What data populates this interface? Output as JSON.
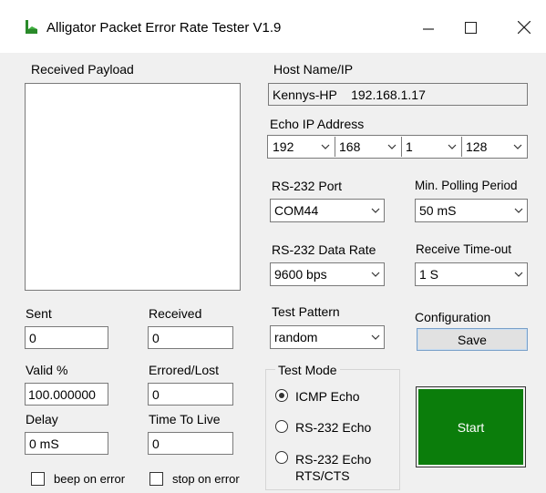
{
  "window": {
    "title": "Alligator Packet Error Rate Tester V1.9",
    "minimize_icon": "minimize-icon",
    "maximize_icon": "maximize-icon",
    "close_icon": "close-icon",
    "app_icon": "alligator-icon"
  },
  "received_payload": {
    "label": "Received Payload",
    "value": ""
  },
  "stats": {
    "sent_label": "Sent",
    "sent_value": "0",
    "received_label": "Received",
    "received_value": "0",
    "valid_label": "Valid %",
    "valid_value": "100.000000",
    "errored_label": "Errored/Lost",
    "errored_value": "0",
    "delay_label": "Delay",
    "delay_value": "0 mS",
    "ttl_label": "Time To Live",
    "ttl_value": "0"
  },
  "options": {
    "beep_label": "beep on error",
    "beep_checked": false,
    "stop_label": "stop on error",
    "stop_checked": false
  },
  "host": {
    "label": "Host Name/IP",
    "value": "Kennys-HP    192.168.1.17"
  },
  "echo_ip": {
    "label": "Echo IP Address",
    "octets": [
      "192",
      "168",
      "1",
      "128"
    ]
  },
  "rs232_port": {
    "label": "RS-232 Port",
    "value": "COM44"
  },
  "polling": {
    "label": "Min. Polling Period",
    "value": "50 mS"
  },
  "data_rate": {
    "label": "RS-232 Data Rate",
    "value": "9600 bps"
  },
  "timeout": {
    "label": "Receive Time-out",
    "value": "1 S"
  },
  "test_pattern": {
    "label": "Test Pattern",
    "value": "random"
  },
  "configuration": {
    "label": "Configuration",
    "save_label": "Save"
  },
  "test_mode": {
    "label": "Test Mode",
    "options": [
      "ICMP Echo",
      "RS-232 Echo",
      "RS-232 Echo",
      "RTS/CTS"
    ],
    "selected": "ICMP Echo"
  },
  "start_button": {
    "label": "Start",
    "color": "#0b7d0b"
  }
}
